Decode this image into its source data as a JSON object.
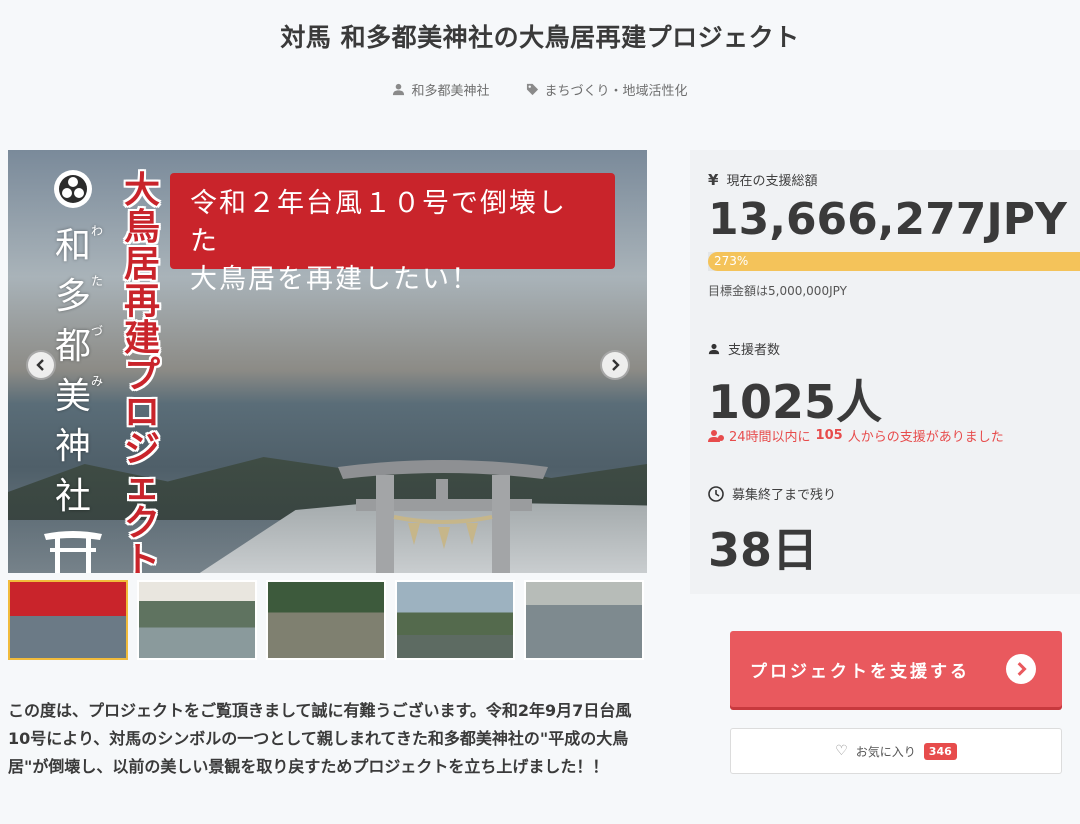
{
  "page": {
    "title": "対馬 和多都美神社の大鳥居再建プロジェクト",
    "owner": "和多都美神社",
    "category": "まちづくり・地域活性化"
  },
  "hero": {
    "vertical_name": "和多都美神社",
    "ruby": "わたづみ",
    "vertical_red": "大鳥居再建プロジェクト",
    "banner_line1": "令和２年台風１０号で倒壊した",
    "banner_line2": "大鳥居を再建したい！"
  },
  "thumbnails": [
    "thumb-1",
    "thumb-2",
    "thumb-3",
    "thumb-4",
    "thumb-5"
  ],
  "stats": {
    "total_label": "現在の支援総額",
    "total_value": "13,666,277JPY",
    "progress_text": "273%",
    "progress_fraction": 1.0,
    "goal_text": "目標金額は5,000,000JPY",
    "supporters_label": "支援者数",
    "supporters_value": "1025人",
    "recent_prefix": "24時間以内に",
    "recent_count": "105",
    "recent_suffix": "人からの支援がありました",
    "remaining_label": "募集終了まで残り",
    "remaining_value": "38日"
  },
  "actions": {
    "support_label": "プロジェクトを支援する",
    "favorite_label": "お気に入り",
    "favorite_count": "346"
  },
  "description": "この度は、プロジェクトをご覧頂きまして誠に有難うございます。令和2年9月7日台風10号により、対馬のシンボルの一つとして親しまれてきた和多都美神社の\"平成の大鳥居\"が倒壊し、以前の美しい景観を取り戻すためプロジェクトを立ち上げました！！",
  "colors": {
    "accent": "#e9595e",
    "progress": "#f4c35a",
    "badge": "#e74c4c",
    "banner_red": "#c9242b"
  }
}
